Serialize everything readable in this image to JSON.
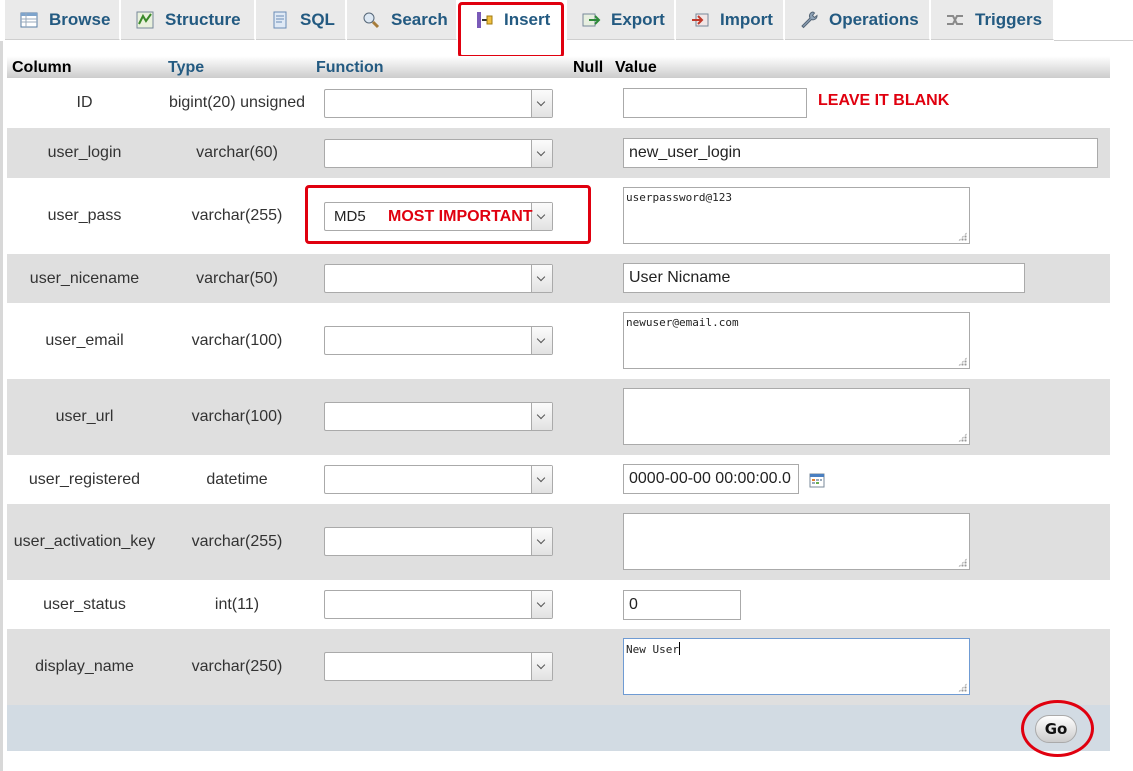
{
  "tabs": [
    {
      "label": "Browse",
      "icon": "browse-icon"
    },
    {
      "label": "Structure",
      "icon": "structure-icon"
    },
    {
      "label": "SQL",
      "icon": "sql-icon"
    },
    {
      "label": "Search",
      "icon": "search-icon"
    },
    {
      "label": "Insert",
      "icon": "insert-icon",
      "active": true
    },
    {
      "label": "Export",
      "icon": "export-icon"
    },
    {
      "label": "Import",
      "icon": "import-icon"
    },
    {
      "label": "Operations",
      "icon": "wrench-icon"
    },
    {
      "label": "Triggers",
      "icon": "triggers-icon"
    }
  ],
  "headers": {
    "column": "Column",
    "type": "Type",
    "function": "Function",
    "null": "Null",
    "value": "Value"
  },
  "rows": [
    {
      "column": "ID",
      "type": "bigint(20) unsigned",
      "function": "",
      "value": ""
    },
    {
      "column": "user_login",
      "type": "varchar(60)",
      "function": "",
      "value": "new_user_login"
    },
    {
      "column": "user_pass",
      "type": "varchar(255)",
      "function": "MD5",
      "value": "userpassword@123"
    },
    {
      "column": "user_nicename",
      "type": "varchar(50)",
      "function": "",
      "value": "User Nicname"
    },
    {
      "column": "user_email",
      "type": "varchar(100)",
      "function": "",
      "value": "newuser@email.com"
    },
    {
      "column": "user_url",
      "type": "varchar(100)",
      "function": "",
      "value": ""
    },
    {
      "column": "user_registered",
      "type": "datetime",
      "function": "",
      "value": "0000-00-00 00:00:00.0"
    },
    {
      "column": "user_activation_key",
      "type": "varchar(255)",
      "function": "",
      "value": ""
    },
    {
      "column": "user_status",
      "type": "int(11)",
      "function": "",
      "value": "0"
    },
    {
      "column": "display_name",
      "type": "varchar(250)",
      "function": "",
      "value": "New User"
    }
  ],
  "annotations": {
    "leave_blank": "LEAVE IT BLANK",
    "most_important": "MOST IMPORTANT"
  },
  "go_label": "Go",
  "colors": {
    "link": "#235a81",
    "annotation_red": "#e0000f",
    "row_alt": "#dfdfdf",
    "footer": "#d2dbe3"
  }
}
